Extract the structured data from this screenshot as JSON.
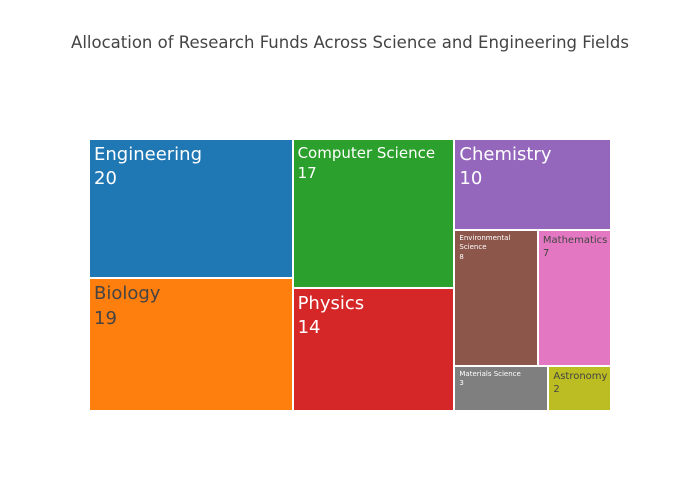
{
  "chart_data": {
    "type": "treemap",
    "title": "Allocation of Research Funds Across Science and Engineering Fields",
    "items": [
      {
        "label": "Engineering",
        "value": 20,
        "color": "#1f77b4",
        "text_color": "#ffffff"
      },
      {
        "label": "Biology",
        "value": 19,
        "color": "#ff7f0e",
        "text_color": "#444444"
      },
      {
        "label": "Computer Science",
        "value": 17,
        "color": "#2ca02c",
        "text_color": "#ffffff"
      },
      {
        "label": "Physics",
        "value": 14,
        "color": "#d62728",
        "text_color": "#ffffff"
      },
      {
        "label": "Chemistry",
        "value": 10,
        "color": "#9467bd",
        "text_color": "#ffffff"
      },
      {
        "label": "Environmental Science",
        "value": 8,
        "color": "#8c564b",
        "text_color": "#ffffff"
      },
      {
        "label": "Mathematics",
        "value": 7,
        "color": "#e377c2",
        "text_color": "#444444"
      },
      {
        "label": "Materials Science",
        "value": 3,
        "color": "#7f7f7f",
        "text_color": "#ffffff"
      },
      {
        "label": "Astronomy",
        "value": 2,
        "color": "#bcbd22",
        "text_color": "#444444"
      }
    ]
  }
}
